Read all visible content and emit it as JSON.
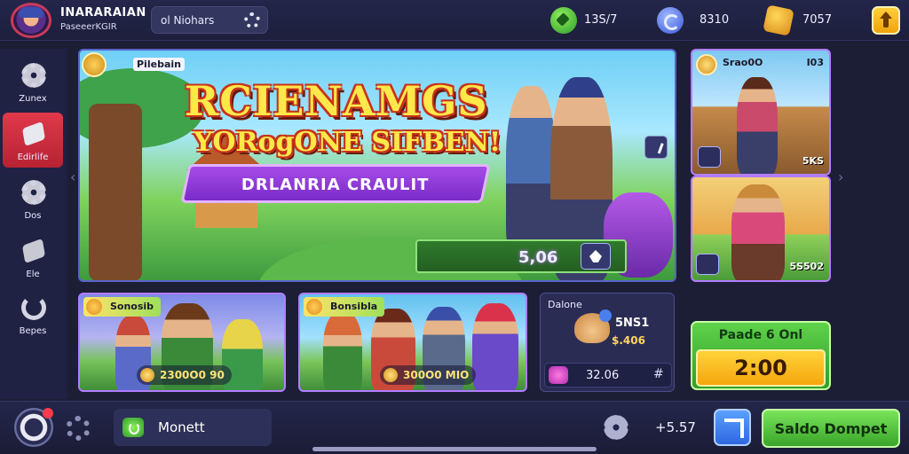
{
  "player": {
    "name": "INARARAIAN",
    "subtitle": "PaseeerKGIR"
  },
  "search": {
    "label": "ol Niohars"
  },
  "currencies": [
    {
      "icon": "gem-icon",
      "value": "13S/7",
      "color": "#3fb83a"
    },
    {
      "icon": "orb-icon",
      "value": "8310",
      "color": "#3a58d8"
    },
    {
      "icon": "gold-icon",
      "value": "7057",
      "color": "#e8a31a"
    }
  ],
  "sidebar": {
    "items": [
      {
        "label": "Zunex",
        "icon": "gear-icon",
        "active": false
      },
      {
        "label": "Edirlife",
        "icon": "block-icon",
        "active": true
      },
      {
        "label": "Dos",
        "icon": "gear-icon",
        "active": false
      },
      {
        "label": "Ele",
        "icon": "block-icon",
        "active": false
      },
      {
        "label": "Bepes",
        "icon": "hook-icon",
        "active": false
      }
    ]
  },
  "hero": {
    "badge_label": "Pilebain",
    "title": "RCIENAMGS",
    "subtitle": "YORogONE SIFBEN!",
    "ribbon": "DRLANRIA CRAULIT",
    "price": "5,06"
  },
  "right_cards": [
    {
      "title": "Srao0O",
      "count": "I03",
      "price": "5KS"
    },
    {
      "title": "",
      "count": "",
      "price": "5S502"
    }
  ],
  "bottom_cards": [
    {
      "tag": "Sonosib",
      "price": "2300O0 90"
    },
    {
      "tag": "Bonsibla",
      "price": "300O0 MIO"
    }
  ],
  "deal_card": {
    "title": "Dalone",
    "amount_primary": "5NS1",
    "amount_secondary": "$.406",
    "row_value": "32.06",
    "row_symbol": "#"
  },
  "timer": {
    "label": "Paade 6 Onl",
    "value": "2:00"
  },
  "bottom_bar": {
    "money_label": "Monett",
    "value": "+5.57",
    "cta_label": "Saldo Dompet"
  },
  "colors": {
    "accent_green": "#3aa52a",
    "accent_gold": "#f4a70c",
    "accent_purple": "#7a2bc8",
    "active_red": "#e0394a",
    "background": "#1c1e36"
  }
}
